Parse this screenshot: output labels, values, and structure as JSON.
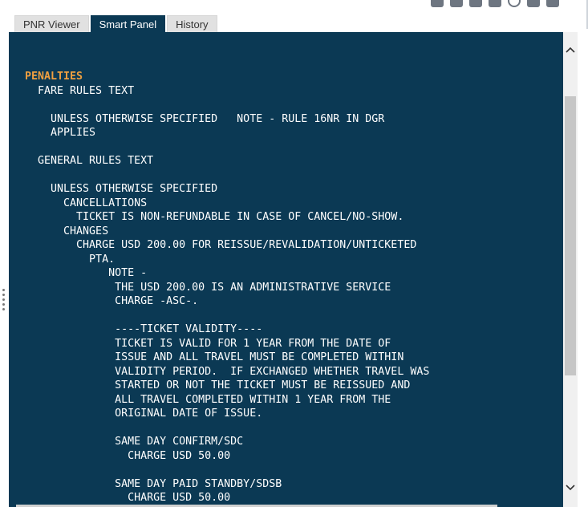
{
  "tabs": [
    {
      "label": "PNR Viewer",
      "active": false
    },
    {
      "label": "Smart Panel",
      "active": true
    },
    {
      "label": "History",
      "active": false
    }
  ],
  "toolbar": {
    "icons": [
      "copy-icon",
      "document-icon",
      "tag-icon",
      "export-icon",
      "info-icon",
      "lock-icon",
      "edit-icon"
    ]
  },
  "rules": {
    "heading": "PENALTIES",
    "lines": [
      "  FARE RULES TEXT",
      "",
      "    UNLESS OTHERWISE SPECIFIED   NOTE - RULE 16NR IN DGR",
      "    APPLIES",
      "",
      "  GENERAL RULES TEXT",
      "",
      "    UNLESS OTHERWISE SPECIFIED",
      "      CANCELLATIONS",
      "        TICKET IS NON-REFUNDABLE IN CASE OF CANCEL/NO-SHOW.",
      "      CHANGES",
      "        CHARGE USD 200.00 FOR REISSUE/REVALIDATION/UNTICKETED",
      "          PTA.",
      "             NOTE -",
      "              THE USD 200.00 IS AN ADMINISTRATIVE SERVICE",
      "              CHARGE -ASC-.",
      "",
      "              ----TICKET VALIDITY----",
      "              TICKET IS VALID FOR 1 YEAR FROM THE DATE OF",
      "              ISSUE AND ALL TRAVEL MUST BE COMPLETED WITHIN",
      "              VALIDITY PERIOD.  IF EXCHANGED WHETHER TRAVEL WAS",
      "              STARTED OR NOT THE TICKET MUST BE REISSUED AND",
      "              ALL TRAVEL COMPLETED WITHIN 1 YEAR FROM THE",
      "              ORIGINAL DATE OF ISSUE.",
      "",
      "              SAME DAY CONFIRM/SDC",
      "                CHARGE USD 50.00",
      "",
      "              SAME DAY PAID STANDBY/SDSB",
      "                CHARGE USD 50.00"
    ]
  },
  "colors": {
    "panel_bg": "#0b3954",
    "heading": "#f0a040",
    "text": "#ffffff"
  }
}
